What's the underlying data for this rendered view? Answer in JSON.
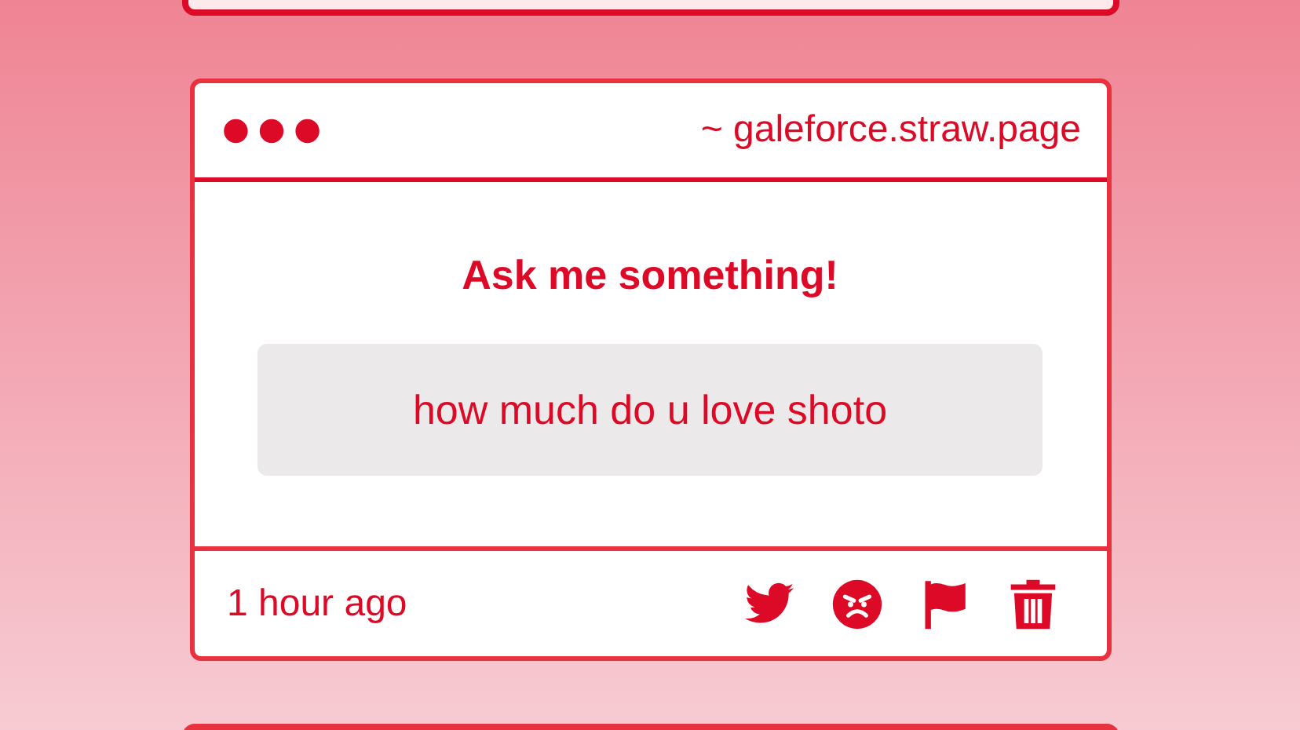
{
  "card": {
    "address": "~ galeforce.straw.page",
    "heading": "Ask me something!",
    "question": "how much do u love shoto",
    "time": "1 hour ago"
  }
}
